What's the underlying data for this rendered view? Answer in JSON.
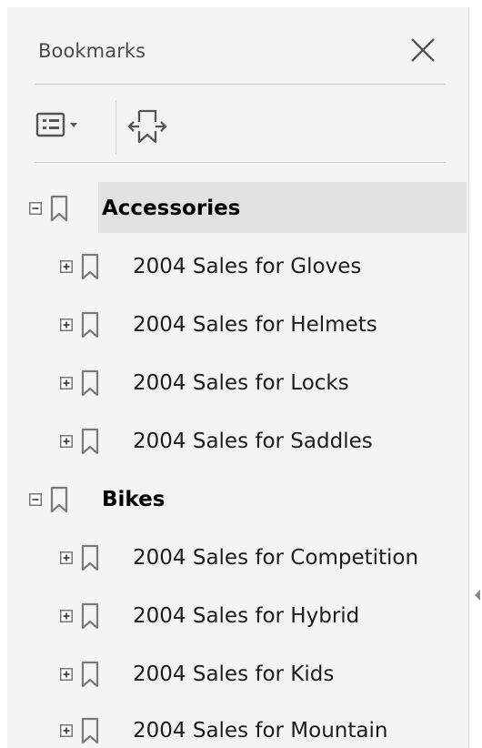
{
  "panel": {
    "title": "Bookmarks",
    "close_icon": "close-x-icon",
    "toolbar": {
      "options_icon": "list-options-icon",
      "expand_icon": "expand-bookmark-icon"
    }
  },
  "bookmarks": [
    {
      "label": "Accessories",
      "level": 0,
      "expanded": true,
      "selected": true,
      "children": [
        {
          "label": "2004 Sales for Gloves",
          "level": 1,
          "expanded": false
        },
        {
          "label": "2004 Sales for Helmets",
          "level": 1,
          "expanded": false
        },
        {
          "label": "2004 Sales for Locks",
          "level": 1,
          "expanded": false
        },
        {
          "label": "2004 Sales for Saddles",
          "level": 1,
          "expanded": false
        }
      ]
    },
    {
      "label": "Bikes",
      "level": 0,
      "expanded": true,
      "selected": false,
      "children": [
        {
          "label": "2004 Sales for Competition",
          "level": 1,
          "expanded": false
        },
        {
          "label": "2004 Sales for Hybrid",
          "level": 1,
          "expanded": false
        },
        {
          "label": "2004 Sales for Kids",
          "level": 1,
          "expanded": false
        },
        {
          "label": "2004 Sales for Mountain",
          "level": 1,
          "expanded": false
        }
      ]
    }
  ],
  "colors": {
    "panel_bg": "#f4f4f4",
    "selected_bg": "#e2e2e2",
    "icon_gray": "#7a7a7a",
    "text": "#1c1c1c"
  }
}
